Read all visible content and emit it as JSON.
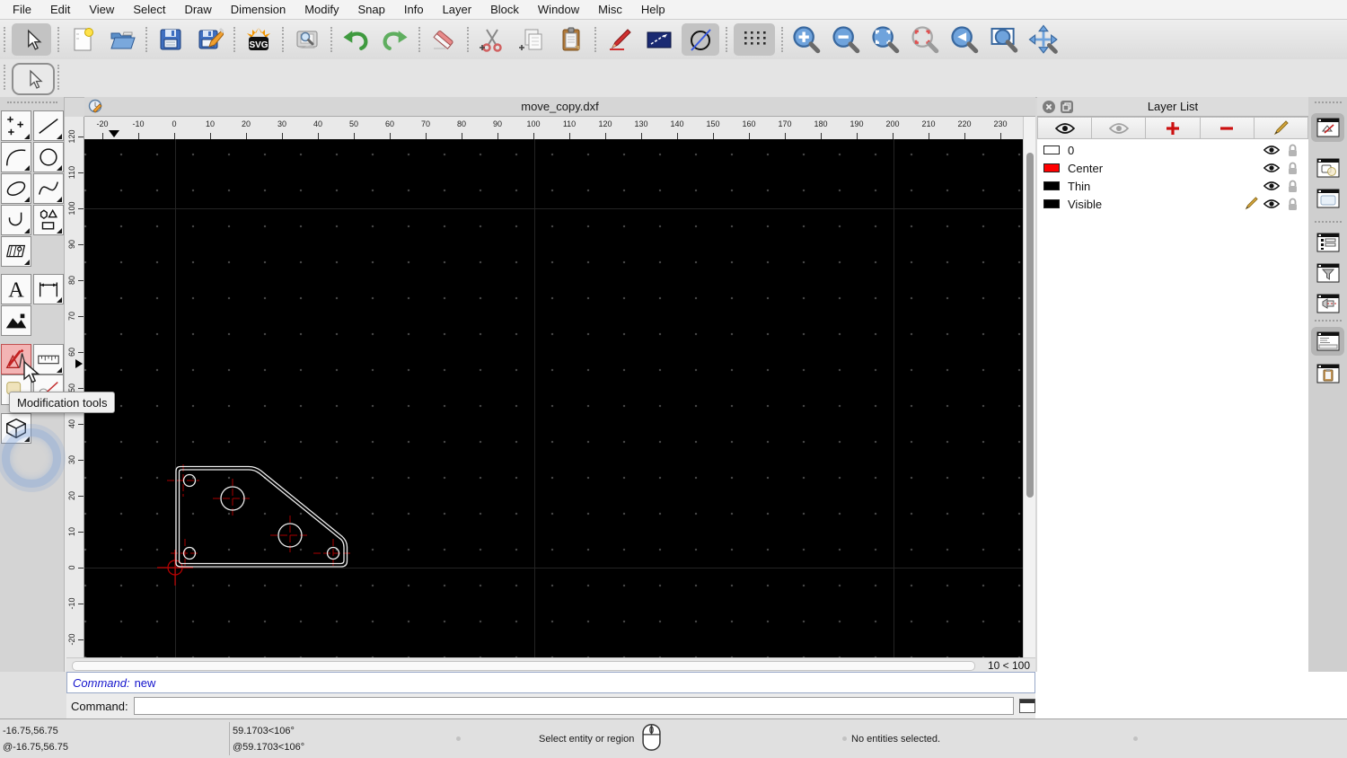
{
  "menu": {
    "items": [
      "File",
      "Edit",
      "View",
      "Select",
      "Draw",
      "Dimension",
      "Modify",
      "Snap",
      "Info",
      "Layer",
      "Block",
      "Window",
      "Misc",
      "Help"
    ]
  },
  "toolbar": {
    "tools": [
      "selection-pointer",
      "new-document",
      "open-file",
      "save",
      "save-as",
      "export-svg",
      "print-preview",
      "undo",
      "redo",
      "delete-eraser",
      "cut",
      "copy",
      "paste",
      "draw-pen",
      "polyline-mode",
      "draft-mode",
      "grid-toggle",
      "zoom-in",
      "zoom-out",
      "zoom-auto",
      "zoom-selection",
      "zoom-previous",
      "zoom-window",
      "zoom-pan"
    ],
    "pressed_toggles": [
      "selection-pointer",
      "draft-mode",
      "grid-toggle"
    ]
  },
  "left_toolbar": {
    "tools": [
      "point-tools",
      "line-tools",
      "arc-tools",
      "circle-tools",
      "ellipse-tools",
      "spline-tools",
      "polyline-tools",
      "shape-tools",
      "hatch-tools",
      "text-tools",
      "dimension-tools",
      "image-tools",
      "modification-tools",
      "measurement-tools",
      "order-tools",
      "block-tools"
    ],
    "highlighted_tool": "modification-tools"
  },
  "mdi_window": {
    "title": "move_copy.dxf"
  },
  "rulers": {
    "horizontal_ticks": [
      -20,
      -10,
      0,
      10,
      20,
      30,
      40,
      50,
      60,
      70,
      80,
      90,
      100,
      110,
      120,
      130,
      140,
      150,
      160,
      170,
      180,
      190,
      200,
      210,
      220,
      230
    ],
    "vertical_ticks": [
      120,
      110,
      100,
      90,
      80,
      70,
      60,
      50,
      40,
      30,
      20,
      10,
      0,
      -10,
      -20
    ]
  },
  "canvas_status": {
    "grid_info": "10 < 100"
  },
  "layer_panel": {
    "title": "Layer List",
    "toolbar_buttons": [
      "show-all-layers",
      "hide-all-layers",
      "add-layer",
      "remove-layer",
      "edit-layer"
    ],
    "layers": [
      {
        "name": "0",
        "color": "#ffffff",
        "current": false
      },
      {
        "name": "Center",
        "color": "#ff0000",
        "current": false
      },
      {
        "name": "Thin",
        "color": "#000000",
        "current": false
      },
      {
        "name": "Visible",
        "color": "#000000",
        "current": true
      }
    ]
  },
  "right_dock": {
    "buttons": [
      "layer-list",
      "block-list",
      "library-browser",
      "list-view",
      "selection-filter",
      "reference-view",
      "command-line",
      "clipboard"
    ],
    "active": [
      "layer-list",
      "command-line"
    ]
  },
  "command_widget": {
    "history_label": "Command:",
    "history_entry": "new",
    "prompt_label": "Command:",
    "input_value": ""
  },
  "status_bar": {
    "absolute_cartesian": "-16.75,56.75",
    "relative_cartesian": "@-16.75,56.75",
    "absolute_polar": "59.1703<106°",
    "relative_polar": "@59.1703<106°",
    "action_hint": "Select entity or region",
    "selection_info": "No entities selected."
  },
  "tooltip": {
    "text": "Modification tools"
  },
  "drawing": {
    "entity_color": "#ededed",
    "center_mark_color": "#a80000",
    "origin_marker_color": "#c00000",
    "large_circle_centers_cad": [
      [
        16,
        19.25
      ],
      [
        32,
        9
      ]
    ],
    "small_hole_centers_cad": [
      [
        4,
        24.25
      ],
      [
        4,
        4
      ],
      [
        44,
        4
      ]
    ],
    "plate_extent_cad": {
      "x": [
        0,
        48
      ],
      "y": [
        0,
        28
      ]
    }
  }
}
